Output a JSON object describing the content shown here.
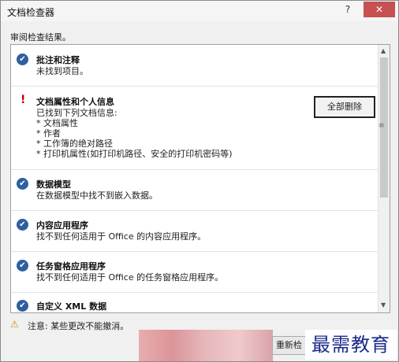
{
  "window": {
    "title": "文档检查器",
    "help_icon": "?",
    "close_icon": "✕"
  },
  "header": {
    "text": "审阅检查结果。"
  },
  "sections": [
    {
      "title": "批注和注释",
      "desc": [
        "未找到项目。"
      ],
      "status": "ok"
    },
    {
      "title": "文档属性和个人信息",
      "desc": [
        "已找到下列文档信息:",
        "* 文档属性",
        "* 作者",
        "* 工作簿的绝对路径",
        "* 打印机属性(如打印机路径、安全的打印机密码等)"
      ],
      "status": "warning",
      "button": "全部删除"
    },
    {
      "title": "数据模型",
      "desc": [
        "在数据模型中找不到嵌入数据。"
      ],
      "status": "ok"
    },
    {
      "title": "内容应用程序",
      "desc": [
        "找不到任何适用于 Office 的内容应用程序。"
      ],
      "status": "ok"
    },
    {
      "title": "任务窗格应用程序",
      "desc": [
        "找不到任何适用于 Office 的任务窗格应用程序。"
      ],
      "status": "ok"
    },
    {
      "title": "自定义 XML 数据",
      "desc": [],
      "status": "ok"
    }
  ],
  "icons": {
    "ok": "✔",
    "warning": "!",
    "footer_warning": "⚠",
    "scroll_up": "▲",
    "scroll_down": "▼",
    "scroll_grip": "≡"
  },
  "colors": {
    "ok_icon": "#2e5f9e",
    "warning": "#c00000"
  },
  "footer": {
    "note": "注意: 某些更改不能撤消。",
    "reinspect_button": "重新检"
  },
  "watermark": "最需教育"
}
